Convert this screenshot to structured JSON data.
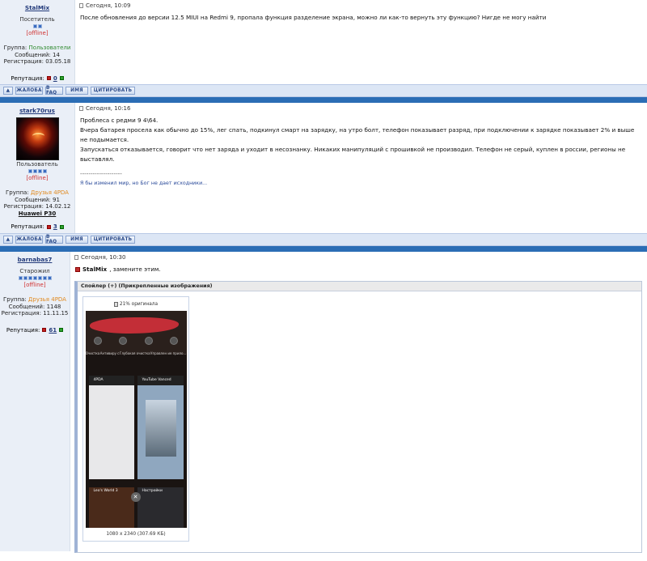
{
  "posts": [
    {
      "username": "StalMix",
      "date": "Сегодня, 10:09",
      "title": "Посетитель",
      "status": "[offline]",
      "group_label": "Группа:",
      "group": "Пользователи",
      "messages_label": "Сообщений:",
      "messages": "14",
      "reg_label": "Регистрация:",
      "registered": "03.05.18",
      "rep_label": "Репутация:",
      "reputation": "0",
      "body": "После обновления до версии 12.5 MIUI на Redmi 9, пропала функция разделение экрана, можно ли как-то вернуть эту функцию? Нигде не могу найти"
    },
    {
      "username": "stark70rus",
      "date": "Сегодня, 10:16",
      "title": "Пользователь",
      "status": "[offline]",
      "group_label": "Группа:",
      "group": "Друзья 4PDA",
      "messages_label": "Сообщений:",
      "messages": "91",
      "reg_label": "Регистрация:",
      "registered": "14.02.12",
      "device": "Huawei P30",
      "rep_label": "Репутация:",
      "reputation": "3",
      "body_lines": [
        "Проблеса с редми 9 4\\64.",
        "Вчера батарея просела как обычно до 15%, лег спать, подкинул смарт на зарядку, на утро болт, телефон показывает разряд, при подключении к зарядке показывает 2% и выше не подымается.",
        "Запускаться отказывается, говорит что нет заряда и уходит в несознанку. Никаких манипуляций с прошивкой не производил. Телефон не серый, куплен в россии, регионы не выставлял."
      ],
      "sig_sep": "--------------------",
      "signature": "Я бы изменил мир, но Бог не дает исходники..."
    },
    {
      "username": "barnabas7",
      "date": "Сегодня, 10:30",
      "title": "Старожил",
      "status": "[offline]",
      "group_label": "Группа:",
      "group": "Друзья 4PDA",
      "messages_label": "Сообщений:",
      "messages": "1148",
      "reg_label": "Регистрация:",
      "registered": "11.11.15",
      "rep_label": "Репутация:",
      "reputation": "61",
      "quote_user": "StalMix",
      "quote_text": ", замените этим.",
      "spoiler_title": "Спойлер (+) (Прикрепленные изображения)",
      "thumb_caption": "21% оригинала",
      "thumb_size": "1080 x 2340 (307.69 КБ)",
      "phone_texts": {
        "labels": [
          "Очистка",
          "Антивиру с",
          "Глубокая очистка",
          "Управлен ие прило..."
        ],
        "card_a": "4PDA",
        "card_b": "YouTube Vanced",
        "card_c": "Leo's World 3",
        "card_d": "Настройки"
      }
    }
  ],
  "actions": {
    "complaint": "ЖАЛОБА",
    "faq": "В FAQ",
    "name": "ИМЯ",
    "quote": "ЦИТИРОВАТЬ"
  },
  "colors": {
    "strip": "#2b6db5",
    "sidebar": "#eaeff7",
    "username": "#223a7a"
  }
}
